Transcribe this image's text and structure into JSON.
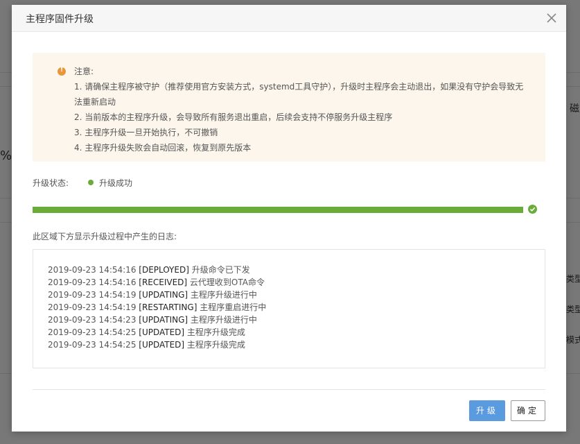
{
  "background": {
    "fragments": [
      "磁",
      "%",
      "类型",
      "类型",
      "模式"
    ]
  },
  "dialog": {
    "title": "主程序固件升级",
    "close_icon": "close-icon"
  },
  "notice": {
    "icon": "warning-icon",
    "heading": "注意:",
    "items": [
      "1. 请确保主程序被守护（推荐使用官方安装方式，systemd工具守护），升级时主程序会主动退出，如果没有守护会导致无",
      "法重新启动",
      "2. 当前版本的主程序升级，会导致所有服务退出重启，后续会支持不停服务升级主程序",
      "3. 主程序升级一旦开始执行，不可撤销",
      "4. 主程序升级失败会自动回滚，恢复到原先版本"
    ]
  },
  "status": {
    "label": "升级状态:",
    "value": "升级成功",
    "color": "#6aac3a"
  },
  "progress": {
    "percent": 100,
    "icon": "check-circle-icon"
  },
  "log": {
    "caption": "此区域下方显示升级过程中产生的日志:",
    "lines": [
      {
        "time": "2019-09-23 14:54:16",
        "code": "[DEPLOYED]",
        "msg": "升级命令已下发"
      },
      {
        "time": "2019-09-23 14:54:16",
        "code": "[RECEIVED]",
        "msg": "云代理收到OTA命令"
      },
      {
        "time": "2019-09-23 14:54:19",
        "code": "[UPDATING]",
        "msg": "主程序升级进行中"
      },
      {
        "time": "2019-09-23 14:54:19",
        "code": "[RESTARTING]",
        "msg": "主程序重启进行中"
      },
      {
        "time": "2019-09-23 14:54:23",
        "code": "[UPDATING]",
        "msg": "主程序升级进行中"
      },
      {
        "time": "2019-09-23 14:54:25",
        "code": "[UPDATED]",
        "msg": "主程序升级完成"
      },
      {
        "time": "2019-09-23 14:54:25",
        "code": "[UPDATED]",
        "msg": "主程序升级完成"
      }
    ]
  },
  "footer": {
    "upgrade_label": "升级",
    "confirm_label": "确定"
  },
  "colors": {
    "primary": "#5a9be0",
    "success": "#6aac3a",
    "warning": "#e8963a",
    "notice_bg": "#fcf6ec"
  }
}
